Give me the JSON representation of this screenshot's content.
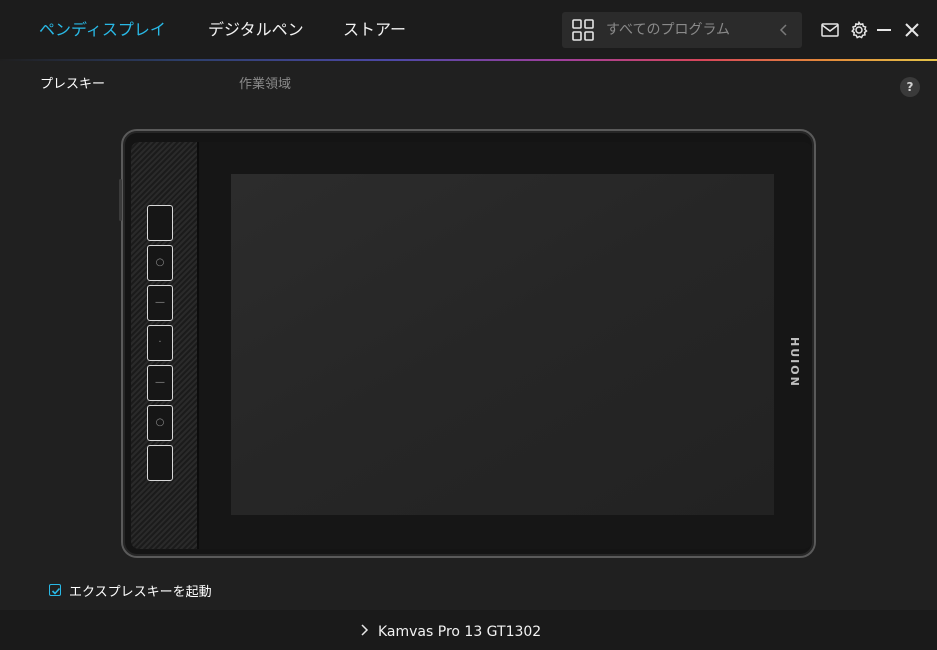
{
  "nav": {
    "tabs": [
      {
        "label": "ペンディスプレイ",
        "active": true
      },
      {
        "label": "デジタルペン",
        "active": false
      },
      {
        "label": "ストアー",
        "active": false
      }
    ]
  },
  "search": {
    "placeholder": "すべてのプログラム"
  },
  "subtabs": {
    "press_keys": "プレスキー",
    "work_area": "作業領域"
  },
  "help": {
    "label": "?"
  },
  "tablet": {
    "brand": "HUION",
    "keys": [
      "",
      "○",
      "—",
      "·",
      "—",
      "○",
      ""
    ]
  },
  "checkbox": {
    "label": "エクスプレスキーを起動",
    "checked": true
  },
  "device": {
    "name": "Kamvas Pro 13 GT1302"
  },
  "colors": {
    "accent": "#29b9e6",
    "background": "#202020"
  }
}
